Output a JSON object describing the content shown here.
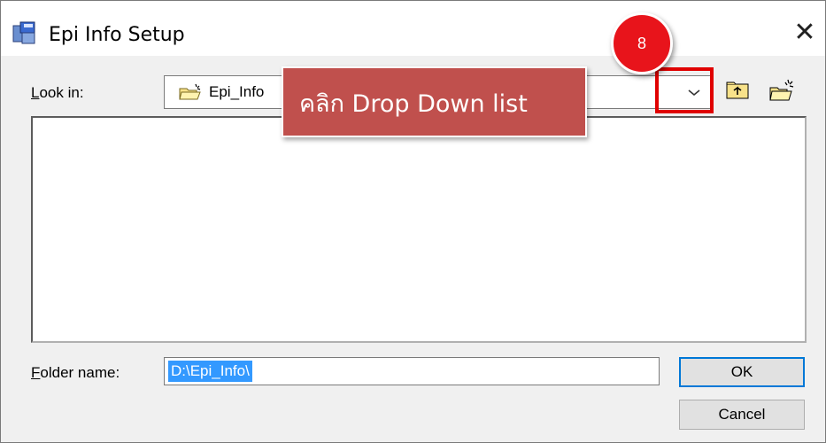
{
  "window": {
    "title": "Epi Info Setup",
    "close_glyph": "✕"
  },
  "look_in": {
    "label_prefix": "",
    "label_accel": "L",
    "label_rest": "ook in:",
    "value": "Epi_Info",
    "arrow_glyph": "⌵"
  },
  "toolbar": {
    "up_icon": "folder-up-icon",
    "new_icon": "new-folder-icon"
  },
  "folder_name": {
    "label_accel": "F",
    "label_rest": "older name:",
    "value": "D:\\Epi_Info\\"
  },
  "buttons": {
    "ok": "OK",
    "cancel": "Cancel"
  },
  "annotation": {
    "callout_text": "คลิก Drop Down list",
    "step_number": "8",
    "highlight_color": "#e00000",
    "callout_color": "#c0504d",
    "step_color": "#e8141b"
  }
}
